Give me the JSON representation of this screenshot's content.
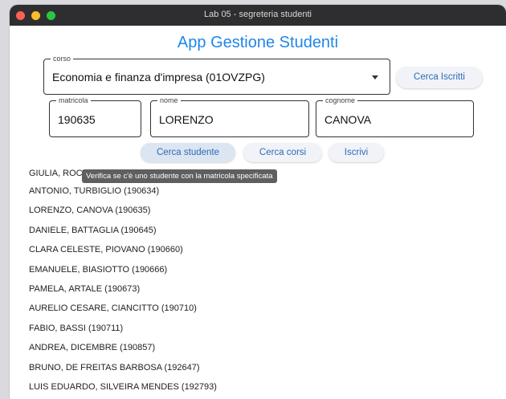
{
  "window": {
    "title": "Lab 05 - segreteria studenti"
  },
  "app": {
    "title": "App Gestione Studenti"
  },
  "corso": {
    "label": "corso",
    "value": "Economia e finanza d'impresa (01OVZPG)"
  },
  "fields": {
    "matricola": {
      "label": "matricola",
      "value": "190635"
    },
    "nome": {
      "label": "nome",
      "value": "LORENZO"
    },
    "cognome": {
      "label": "cognome",
      "value": "CANOVA"
    }
  },
  "buttons": {
    "cerca_iscritti": "Cerca Iscritti",
    "cerca_studente": "Cerca studente",
    "cerca_corsi": "Cerca corsi",
    "iscrivi": "Iscrivi"
  },
  "tooltip": "Verifica se c'è uno studente con la matricola specificata",
  "results": [
    "GIULIA, ROC",
    "ANTONIO, TURBIGLIO (190634)",
    "LORENZO, CANOVA (190635)",
    "DANIELE, BATTAGLIA (190645)",
    "CLARA CELESTE, PIOVANO (190660)",
    "EMANUELE, BIASIOTTO (190666)",
    "PAMELA, ARTALE (190673)",
    "AURELIO CESARE, CIANCITTO (190710)",
    "FABIO, BASSI (190711)",
    "ANDREA, DICEMBRE (190857)",
    "BRUNO, DE FREITAS BARBOSA (192647)",
    "LUIS EDUARDO, SILVEIRA MENDES (192793)"
  ],
  "colors": {
    "accent": "#1f87e8",
    "button_text": "#2a6bb6",
    "titlebar": "#2e2e30"
  },
  "icons": {
    "dropdown": "chevron-down-icon"
  }
}
